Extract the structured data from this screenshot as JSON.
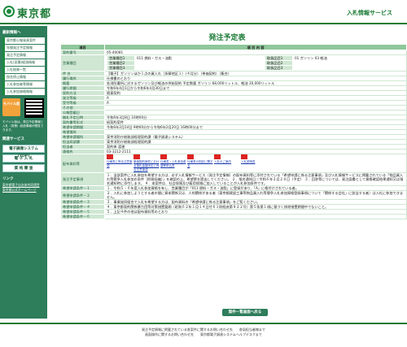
{
  "header": {
    "logo": "東京都",
    "service": "入札情報サービス"
  },
  "sidebar": {
    "section1": "最新情報へ",
    "items": [
      "東京都公報発表案件",
      "年間発注予定情報",
      "発注予定情報",
      "入札(見積)経過情報",
      "入札結果一覧",
      "指名停止情報",
      "入札参加者等情報",
      "入札参加資格情報"
    ],
    "mobile_label": "モバイル版",
    "mobile_note": "モバイル版は、発注予定情報と入札（見積）経過情報が閲覧できます。",
    "section2": "関連サービス",
    "btn_system": "電子調達システム(TOP)",
    "btn_nyusatsu": "電 子 入 札",
    "btn_shikaku": "資 格 審 査",
    "section3": "リンク",
    "links": [
      "東京都電子自治体共同運営",
      "東京都公式ホームページ"
    ]
  },
  "page": {
    "title": "発注予定表"
  },
  "table": {
    "col_item": "項目",
    "col_content": "項 目 内 容",
    "rows": [
      {
        "label": "契約番号",
        "value": "05-40081"
      },
      {
        "label": "営業種目",
        "sub": [
          [
            "営業種目1",
            "011 燃料・ガス・油脂",
            "取扱品目1",
            "01 ガソリン 03 軽油"
          ],
          [
            "営業種目2",
            "",
            "取扱品目2",
            ""
          ],
          [
            "営業種目3",
            "",
            "取扱品目3",
            ""
          ]
        ]
      },
      {
        "label": "件 名",
        "value": "【電子】ガソリンほか１点の買入れ（多摩地区１）（４月分）（単価契約）（集合）"
      },
      {
        "label": "履行場所",
        "value": "仕様書のとおり"
      },
      {
        "label": "概要",
        "value": "各消防署所に対するガソリン及び軽油の供給契約 予定数量 ガソリン 68,000リットル、軽油 30,000リットル"
      },
      {
        "label": "履行期間",
        "value": "令和6年4月1日から令和6年4月30日まで"
      },
      {
        "label": "契約方法",
        "value": "随意契約"
      },
      {
        "label": "発注等級",
        "value": "A"
      },
      {
        "label": "受付等級",
        "value": "A"
      },
      {
        "label": "その他",
        "value": ""
      },
      {
        "label": "公報登載日",
        "value": ""
      },
      {
        "label": "開札予定日時",
        "value": "令和6年3月8日 10時00分"
      },
      {
        "label": "契約書等形式",
        "value": "紙契約案件"
      },
      {
        "label": "希望申請期間",
        "value": "令和6年2月14日 9時00分から令和6年2月20日 16時00分まで"
      },
      {
        "label": "希望場所",
        "value": ""
      },
      {
        "label": "希望申請場所",
        "value": "東京消防庁総務部経理契約課（電子調達システム）"
      },
      {
        "label": "担当局部課",
        "value": "東京消防庁総務部経理契約課"
      },
      {
        "label": "担当者",
        "value": "契約係 渡邊"
      },
      {
        "label": "連絡先",
        "value": "03-3212-2111"
      },
      {
        "label": "配布資料等",
        "attachments": [
          "仕様書に係る注意事項",
          "単価契約案件における落札金額決定に係る注意事項",
          "仕様書・入札参加希望等申込書",
          "仕様書の別記に関する",
          "入札のご案内",
          "入札説明書"
        ]
      },
      {
        "label": "発注予定事項",
        "value": "１．当該案件に入札参加を希望する方は、必ず入札情報サービス（発注予定情報）の配布資料等に添付されている「希望申請に係る注意事項」及び入札情報サービスに掲載されている「物品買入れ等競争入札参加の条件（財務局編）」を確認の上、希望票を提出してください。 ２．指名通知日＝令和６年２月２８日（予定） ３．回答等については、発注図書として資格確認結果通知又は指名通知時に添付します。 ４．本案件は、社会保険及び雇用保険に加入していることが入札参加条件です。"
      },
      {
        "label": "希望申請条件－１",
        "value": "１．令和５・６年度入札参加資格を有し、営業種目が「011 燃料・ガス・油脂」に登録があり、「A」に格付けされている者。"
      },
      {
        "label": "希望申請条件－２",
        "value": "２．入札に参加しようとする者の間に資本関係又は、人的関係がある者（東京都建設工事等物品買入れ等競争入札参加資格登録事項について「関係する会社」に該当する者）は入札に参加できません。"
      },
      {
        "label": "希望申請条件－３",
        "value": "３．事業協同組合で入札を希望する方は、配布資料の「希望申請に係る注意事項」をご覧ください。"
      },
      {
        "label": "希望申請条件－４",
        "value": "４．東京都契約関係暴力団等対策措置要綱（昭和６２年１月１４日付６１財経庶第９２２号）第５条第１項に基づく排除措置期間中でないこと。"
      },
      {
        "label": "希望申請条件－５",
        "value": "５．上記４件の他は配布資料等のとおり"
      },
      {
        "label": "希望申請条件－６",
        "value": ""
      }
    ]
  },
  "back_button": "案件一覧画面へ戻る",
  "footer": {
    "line1": "発注予定情報に掲載されている各案件に関するお問い合わせ先　　各局担当者様まで",
    "line2": "画面操作に関するお問い合わせ先　　東京都電子調達システムヘルプデスクまで"
  }
}
